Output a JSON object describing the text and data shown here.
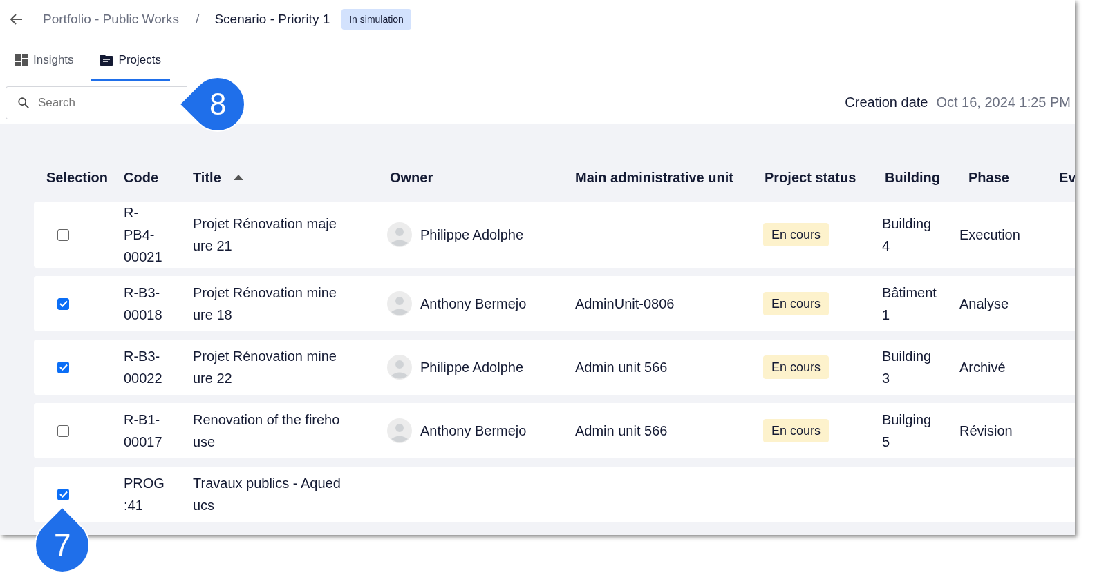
{
  "header": {
    "breadcrumb_parent": "Portfolio - Public Works",
    "separator": "/",
    "title": "Scenario - Priority 1",
    "badge": "In simulation"
  },
  "tabs": [
    {
      "label": "Insights",
      "selected": false
    },
    {
      "label": "Projects",
      "selected": true
    }
  ],
  "search": {
    "placeholder": "Search"
  },
  "creation_date": {
    "label": "Creation date",
    "value": "Oct 16, 2024 1:25 PM"
  },
  "table": {
    "columns": [
      {
        "label": "Selection"
      },
      {
        "label": "Code"
      },
      {
        "label": "Title",
        "sorted": true
      },
      {
        "label": "Owner"
      },
      {
        "label": "Main administrative unit"
      },
      {
        "label": "Project status"
      },
      {
        "label": "Building"
      },
      {
        "label": "Phase"
      },
      {
        "label": "Ev"
      }
    ],
    "rows": [
      {
        "checked": false,
        "code": "R-PB4-00021",
        "title": "Projet Rénovation majeure 21",
        "owner": "Philippe Adolphe",
        "status": "En cours",
        "building": "Building 4",
        "phase": "Execution"
      },
      {
        "checked": true,
        "code": "R-B3-00018",
        "title": "Projet Rénovation mineure 18",
        "owner": "Anthony Bermejo",
        "admin_unit": "AdminUnit-0806",
        "status": "En cours",
        "building": "Bâtiment 1",
        "phase": "Analyse"
      },
      {
        "checked": true,
        "code": "R-B3-00022",
        "title": "Projet Rénovation mineure 22",
        "owner": "Philippe Adolphe",
        "admin_unit": "Admin unit 566",
        "status": "En cours",
        "building": "Building 3",
        "phase": "Archivé"
      },
      {
        "checked": false,
        "code": "R-B1-00017",
        "title": "Renovation of the firehouse",
        "owner": "Anthony Bermejo",
        "admin_unit": "Admin unit 566",
        "status": "En cours",
        "building": "Builging 5",
        "phase": "Révision"
      },
      {
        "checked": true,
        "code": "PROG:41",
        "title": "Travaux publics - Aqueducs"
      }
    ]
  },
  "callouts": [
    {
      "label": "8"
    },
    {
      "label": "7"
    }
  ]
}
